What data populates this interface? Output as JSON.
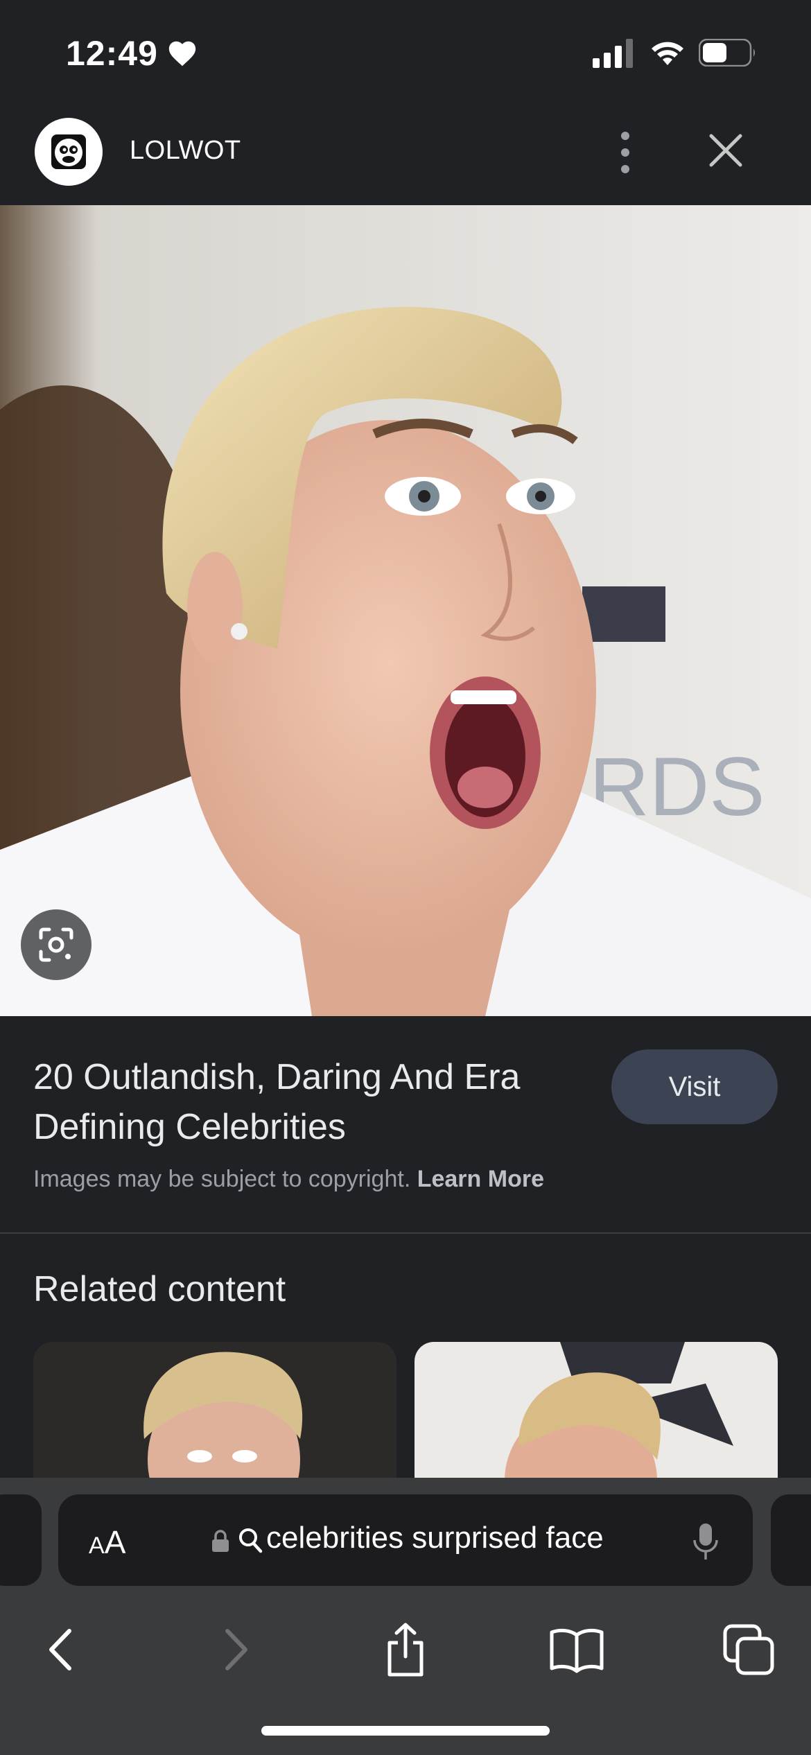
{
  "status": {
    "time": "12:49",
    "icons": [
      "heart-icon",
      "cellular-signal-icon",
      "wifi-icon",
      "battery-icon"
    ]
  },
  "header": {
    "site_name": "LOLWOT",
    "icons": [
      "site-logo-icon",
      "more-vertical-icon",
      "close-icon"
    ]
  },
  "result": {
    "title": "20 Outlandish, Daring And Era Defining Celebrities",
    "visit_label": "Visit",
    "copyright_text": "Images may be subject to copyright.",
    "learn_more_label": "Learn More",
    "lens_icon": "google-lens-icon"
  },
  "related": {
    "heading": "Related content"
  },
  "browser": {
    "aa_label_small": "A",
    "aa_label_big": "A",
    "url_text": "celebrities surprised face",
    "icons": [
      "lock-icon",
      "search-icon",
      "microphone-icon",
      "back-icon",
      "forward-icon",
      "share-icon",
      "bookmarks-icon",
      "tabs-icon"
    ]
  },
  "colors": {
    "background": "#202124",
    "visit_button": "#3c4353",
    "toolbar": "#3a3b3d"
  }
}
